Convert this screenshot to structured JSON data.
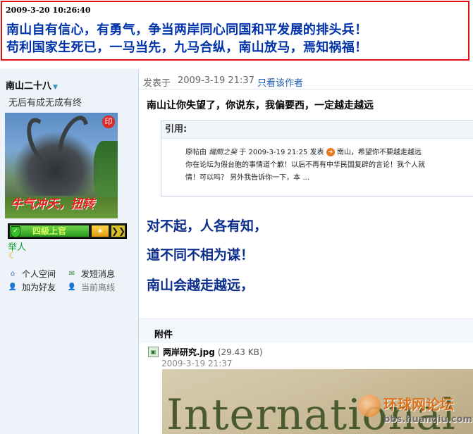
{
  "banner": {
    "timestamp": "2009-3-20 10:26:40",
    "line1": "南山自有信心，有勇气，争当两岸同心同国和平发展的排头兵！",
    "line2": "苟利国家生死已，一马当先，九马合纵，南山放马，焉知祸福！"
  },
  "sidebar": {
    "username": "南山二十八",
    "motto": "无后有成无成有终",
    "avatar_caption": "牛气冲天，扭转",
    "rank_badge_label": "四級上官",
    "rank_title": "举人",
    "links": {
      "personal_space": "个人空间",
      "send_message": "发短消息",
      "add_friend": "加为好友",
      "status": "当前离线"
    }
  },
  "post": {
    "posted_label": "发表于",
    "posted_time": "2009-3-19 21:37",
    "only_author": "只看该作者",
    "title": "南山让你失望了，你说东，我偏要西，一定越走越远",
    "quote": {
      "header": "引用:",
      "line1_prefix": "原帖由",
      "quoted_author": "鐵闕之癸",
      "line1_mid": "于 2009-3-19 21:25 发表",
      "line1_text": "南山，希望你不要越走越远",
      "line2": "你在论坛为假台胞的事情道个歉！以后不再有中华民国复辟的言论！我个人就",
      "line3": "情！可以吗？   另外我告诉你一下，本 ..."
    },
    "body": [
      "对不起，人各有知，",
      "道不同不相为谋！",
      "南山会越走越远，"
    ]
  },
  "attachment": {
    "header": "附件",
    "file_name": "两岸研究.jpg",
    "file_size": "(29.43 KB)",
    "file_date": "2009-3-19 21:37",
    "image_text": "International"
  },
  "watermark": {
    "name": "环球网论坛",
    "url": "bbs.huanqiu.com"
  }
}
